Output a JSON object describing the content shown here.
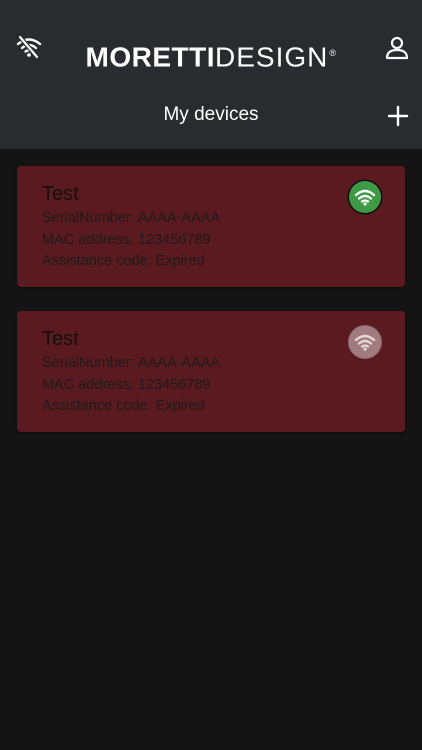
{
  "header": {
    "logo_bold": "MORETTI",
    "logo_light": "DESIGN",
    "logo_reg": "®",
    "title": "My devices"
  },
  "icons": {
    "connection": "wifi-off-icon",
    "account": "user-icon",
    "add": "plus-icon"
  },
  "colors": {
    "topbar": "#2a2b2f",
    "background": "#141414",
    "card": "#5b1a1f",
    "online": "#3d9b45",
    "offline": "#a07c80"
  },
  "devices": [
    {
      "name": "Test",
      "serial": "SerialNumber: AAAA-AAAA",
      "mac": "MAC address: 123456789",
      "assistance": "Assistance code: Expired",
      "status": "online"
    },
    {
      "name": "Test",
      "serial": "SerialNumber: AAAA-AAAA",
      "mac": "MAC address: 123456789",
      "assistance": "Assistance code: Expired",
      "status": "offline"
    }
  ]
}
